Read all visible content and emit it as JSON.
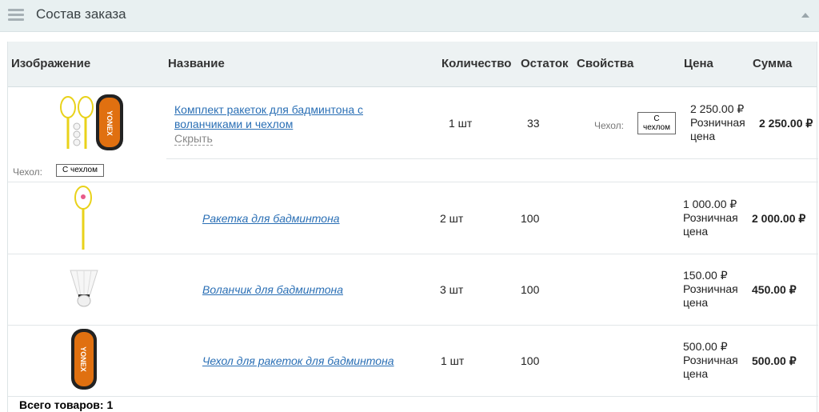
{
  "header": {
    "title": "Состав заказа",
    "menu_icon": "hamburger-menu-icon",
    "collapse_icon": "collapse-arrow-icon"
  },
  "columns": {
    "image": "Изображение",
    "name": "Название",
    "quantity": "Количество",
    "stock": "Остаток",
    "properties": "Свойства",
    "price": "Цена",
    "sum": "Сумма"
  },
  "set_item": {
    "name_line1": "Комплект ракеток для бадминтона с",
    "name_line2": "воланчиками и чехлом",
    "hide_label": "Скрыть",
    "quantity": "1 шт",
    "stock": "33",
    "property_label": "Чехол:",
    "property_value_line1": "С",
    "property_value_line2": "чехлом",
    "price": "2 250.00 ₽",
    "price_type_line1": "Розничная",
    "price_type_line2": "цена",
    "sum": "2 250.00 ₽",
    "image_property_label": "Чехол:",
    "image_property_value": "С чехлом"
  },
  "sub_items": [
    {
      "name": "Ракетка для бадминтона",
      "quantity": "2 шт",
      "stock": "100",
      "price": "1 000.00 ₽",
      "price_type_line1": "Розничная",
      "price_type_line2": "цена",
      "sum": "2 000.00 ₽"
    },
    {
      "name": "Воланчик для бадминтона",
      "quantity": "3 шт",
      "stock": "100",
      "price": "150.00 ₽",
      "price_type_line1": "Розничная",
      "price_type_line2": "цена",
      "sum": "450.00 ₽"
    },
    {
      "name": "Чехол для ракеток для бадминтона",
      "quantity": "1 шт",
      "stock": "100",
      "price": "500.00 ₽",
      "price_type_line1": "Розничная",
      "price_type_line2": "цена",
      "sum": "500.00 ₽"
    }
  ],
  "footer": {
    "total": "Всего товаров: 1"
  },
  "colors": {
    "link": "#2a6fb5",
    "header_bg": "#edf2f3",
    "topbar_bg": "#e8f0f1",
    "racket_yellow": "#e9d21a",
    "bag_orange": "#e07010"
  }
}
